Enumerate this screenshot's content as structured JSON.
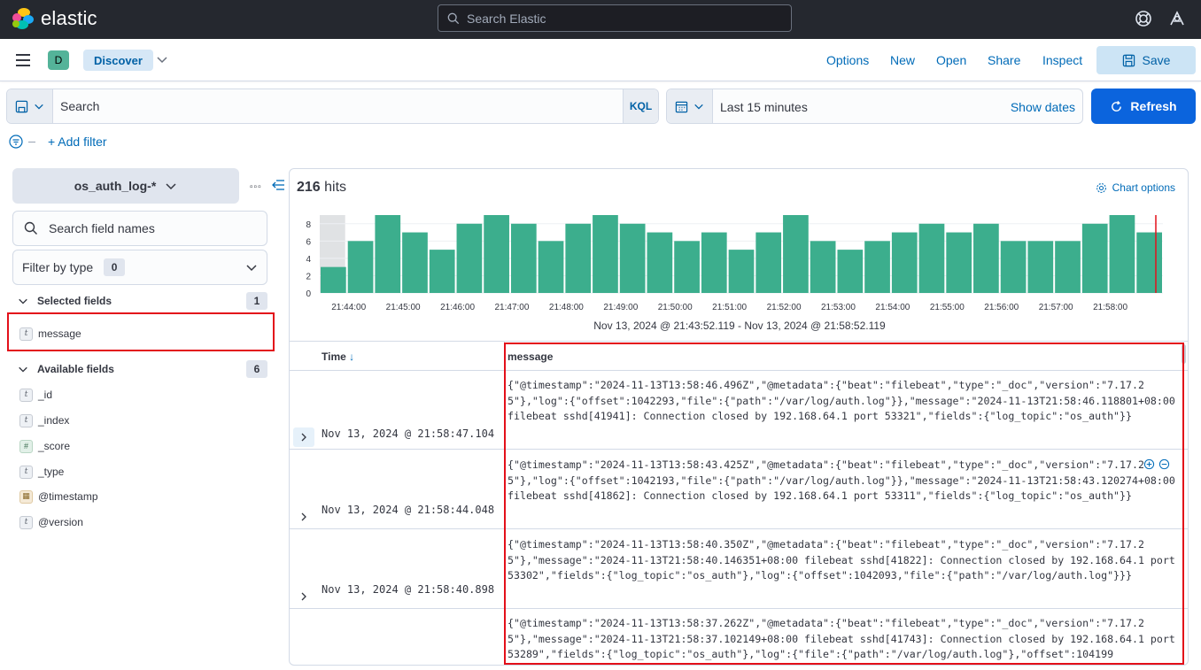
{
  "topbar": {
    "brand": "elastic",
    "search_placeholder": "Search Elastic",
    "icons": [
      "help-icon",
      "user-menu-icon"
    ]
  },
  "header": {
    "space_initial": "D",
    "breadcrumb": "Discover",
    "links": [
      "Options",
      "New",
      "Open",
      "Share",
      "Inspect"
    ],
    "save_label": "Save"
  },
  "query": {
    "placeholder": "Search",
    "language": "KQL",
    "time_range": "Last 15 minutes",
    "show_dates": "Show dates",
    "refresh_label": "Refresh",
    "add_filter": "+ Add filter"
  },
  "sidebar": {
    "index_pattern": "os_auth_log-*",
    "field_search_placeholder": "Search field names",
    "filter_by_type": "Filter by type",
    "filter_count": "0",
    "selected_title": "Selected fields",
    "selected_count": "1",
    "selected_fields": [
      {
        "type": "t",
        "name": "message"
      }
    ],
    "available_title": "Available fields",
    "available_count": "6",
    "available_fields": [
      {
        "type": "t",
        "name": "_id"
      },
      {
        "type": "t",
        "name": "_index"
      },
      {
        "type": "#",
        "name": "_score"
      },
      {
        "type": "t",
        "name": "_type"
      },
      {
        "type": "date",
        "name": "@timestamp"
      },
      {
        "type": "t",
        "name": "@version"
      }
    ]
  },
  "results": {
    "hits_count": "216",
    "hits_label": "hits",
    "chart_options": "Chart options",
    "date_range": "Nov 13, 2024 @ 21:43:52.119 - Nov 13, 2024 @ 21:58:52.119",
    "col_time": "Time",
    "col_message": "message",
    "rows": [
      {
        "time": "Nov 13, 2024 @ 21:58:47.104",
        "message": "{\"@timestamp\":\"2024-11-13T13:58:46.496Z\",\"@metadata\":{\"beat\":\"filebeat\",\"type\":\"_doc\",\"version\":\"7.17.25\"},\"log\":{\"offset\":1042293,\"file\":{\"path\":\"/var/log/auth.log\"}},\"message\":\"2024-11-13T21:58:46.118801+08:00 filebeat sshd[41941]: Connection closed by 192.168.64.1 port 53321\",\"fields\":{\"log_topic\":\"os_auth\"}}"
      },
      {
        "time": "Nov 13, 2024 @ 21:58:44.048",
        "message": "{\"@timestamp\":\"2024-11-13T13:58:43.425Z\",\"@metadata\":{\"beat\":\"filebeat\",\"type\":\"_doc\",\"version\":\"7.17.25\"},\"log\":{\"offset\":1042193,\"file\":{\"path\":\"/var/log/auth.log\"}},\"message\":\"2024-11-13T21:58:43.120274+08:00 filebeat sshd[41862]: Connection closed by 192.168.64.1 port 53311\",\"fields\":{\"log_topic\":\"os_auth\"}}"
      },
      {
        "time": "Nov 13, 2024 @ 21:58:40.898",
        "message": "{\"@timestamp\":\"2024-11-13T13:58:40.350Z\",\"@metadata\":{\"beat\":\"filebeat\",\"type\":\"_doc\",\"version\":\"7.17.25\"},\"message\":\"2024-11-13T21:58:40.146351+08:00 filebeat sshd[41822]: Connection closed by 192.168.64.1 port 53302\",\"fields\":{\"log_topic\":\"os_auth\"},\"log\":{\"offset\":1042093,\"file\":{\"path\":\"/var/log/auth.log\"}}}"
      },
      {
        "time": "",
        "message": "{\"@timestamp\":\"2024-11-13T13:58:37.262Z\",\"@metadata\":{\"beat\":\"filebeat\",\"type\":\"_doc\",\"version\":\"7.17.25\"},\"message\":\"2024-11-13T21:58:37.102149+08:00 filebeat sshd[41743]: Connection closed by 192.168.64.1 port 53289\",\"fields\":{\"log_topic\":\"os_auth\"},\"log\":{\"file\":{\"path\":\"/var/log/auth.log\"},\"offset\":104199"
      }
    ]
  },
  "chart_data": {
    "type": "bar",
    "y_ticks": [
      "0",
      "2",
      "4",
      "6",
      "8"
    ],
    "ylim": [
      0,
      9
    ],
    "x_ticks": [
      "21:44:00",
      "21:45:00",
      "21:46:00",
      "21:47:00",
      "21:48:00",
      "21:49:00",
      "21:50:00",
      "21:51:00",
      "21:52:00",
      "21:53:00",
      "21:54:00",
      "21:55:00",
      "21:56:00",
      "21:57:00",
      "21:58:00"
    ],
    "values": [
      3,
      6,
      9,
      7,
      5,
      8,
      9,
      8,
      6,
      8,
      9,
      8,
      7,
      6,
      7,
      5,
      7,
      9,
      6,
      5,
      6,
      7,
      8,
      7,
      8,
      6,
      6,
      6,
      8,
      9,
      7
    ],
    "bar_color": "#3cae8d",
    "partial_bucket_shade": "#d3d5d8",
    "now_marker_color": "#e3101a"
  }
}
